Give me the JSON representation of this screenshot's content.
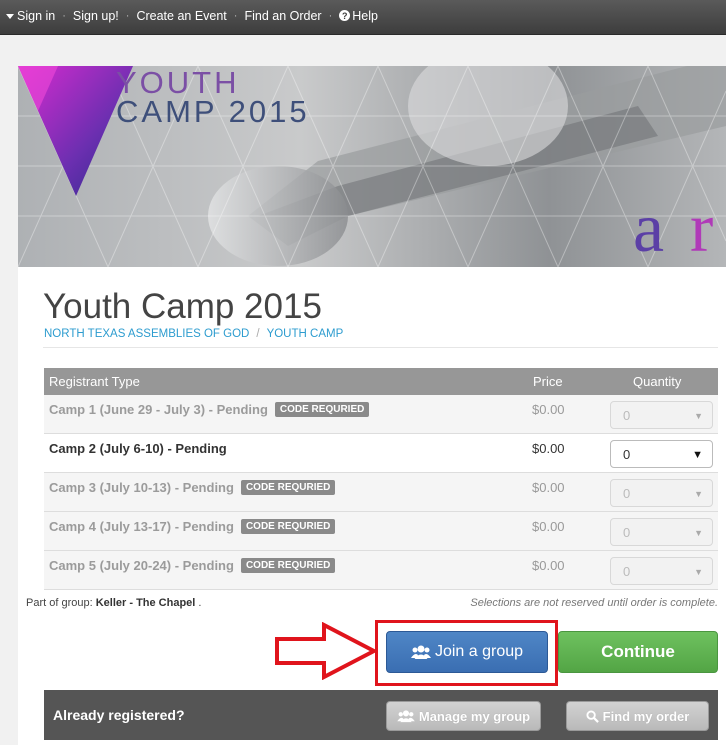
{
  "nav": {
    "sign_in": "Sign in",
    "sign_up": "Sign up!",
    "create_event": "Create an Event",
    "find_order": "Find an Order",
    "help": "Help",
    "separator": "·"
  },
  "banner": {
    "line1": "YOUTH",
    "line2": "CAMP 2015"
  },
  "event": {
    "title": "Youth Camp 2015",
    "breadcrumb": [
      "NORTH TEXAS ASSEMBLIES OF GOD",
      "YOUTH CAMP"
    ]
  },
  "table": {
    "headers": {
      "type": "Registrant Type",
      "price": "Price",
      "quantity": "Quantity"
    },
    "code_badge": "CODE REQURIED",
    "rows": [
      {
        "name": "Camp 1 (June 29 - July 3) - Pending",
        "price": "$0.00",
        "qty": "0",
        "code_required": true
      },
      {
        "name": "Camp 2 (July 6-10) - Pending",
        "price": "$0.00",
        "qty": "0",
        "code_required": false
      },
      {
        "name": "Camp 3 (July 10-13) - Pending",
        "price": "$0.00",
        "qty": "0",
        "code_required": true
      },
      {
        "name": "Camp 4 (July 13-17) - Pending",
        "price": "$0.00",
        "qty": "0",
        "code_required": true
      },
      {
        "name": "Camp 5 (July 20-24) - Pending",
        "price": "$0.00",
        "qty": "0",
        "code_required": true
      }
    ]
  },
  "group_note": {
    "prefix": "Part of group: ",
    "group": "Keller - The Chapel",
    "suffix": " ."
  },
  "reserve_note": "Selections are not reserved until order is complete.",
  "buttons": {
    "join_group": "Join a group",
    "continue": "Continue",
    "manage_group": "Manage my group",
    "find_order": "Find my order"
  },
  "already_registered": "Already registered?",
  "icons": {
    "join": "users-icon",
    "manage": "users-icon",
    "find": "search-icon",
    "annotation": "red-arrow-icon"
  },
  "colors": {
    "link": "#2d9ccf",
    "join": "#4478bb",
    "continue": "#5cb24e",
    "annotation": "#e0141c"
  }
}
